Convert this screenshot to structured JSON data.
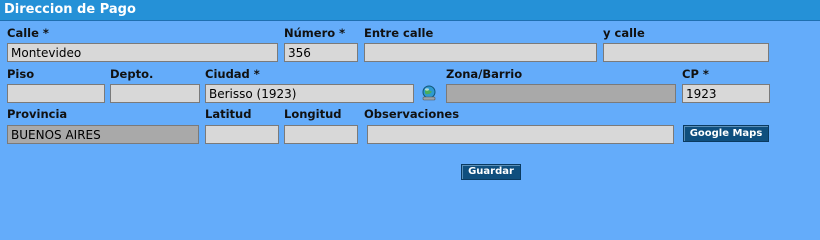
{
  "form": {
    "title": "Direccion de Pago",
    "labels": {
      "calle": "Calle *",
      "numero": "Número *",
      "entre_calle": "Entre calle",
      "y_calle": "y calle",
      "piso": "Piso",
      "depto": "Depto.",
      "ciudad": "Ciudad *",
      "zona_barrio": "Zona/Barrio",
      "cp": "CP *",
      "provincia": "Provincia",
      "latitud": "Latitud",
      "longitud": "Longitud",
      "observaciones": "Observaciones"
    },
    "values": {
      "calle": "Montevideo",
      "numero": "356",
      "entre_calle": "",
      "y_calle": "",
      "piso": "",
      "depto": "",
      "ciudad": "Berisso (1923)",
      "zona_barrio": "",
      "cp": "1923",
      "provincia": "BUENOS AIRES",
      "latitud": "",
      "longitud": "",
      "observaciones": ""
    },
    "buttons": {
      "google_maps": "Google Maps",
      "guardar": "Guardar"
    },
    "icons": {
      "ciudad_lookup": "globe-search-icon"
    }
  },
  "colors": {
    "background": "#64acfa",
    "title_bar": "#2591d7",
    "button": "#0f4f7e",
    "field": "#d8d8d8",
    "field_disabled": "#a9a9a9"
  }
}
